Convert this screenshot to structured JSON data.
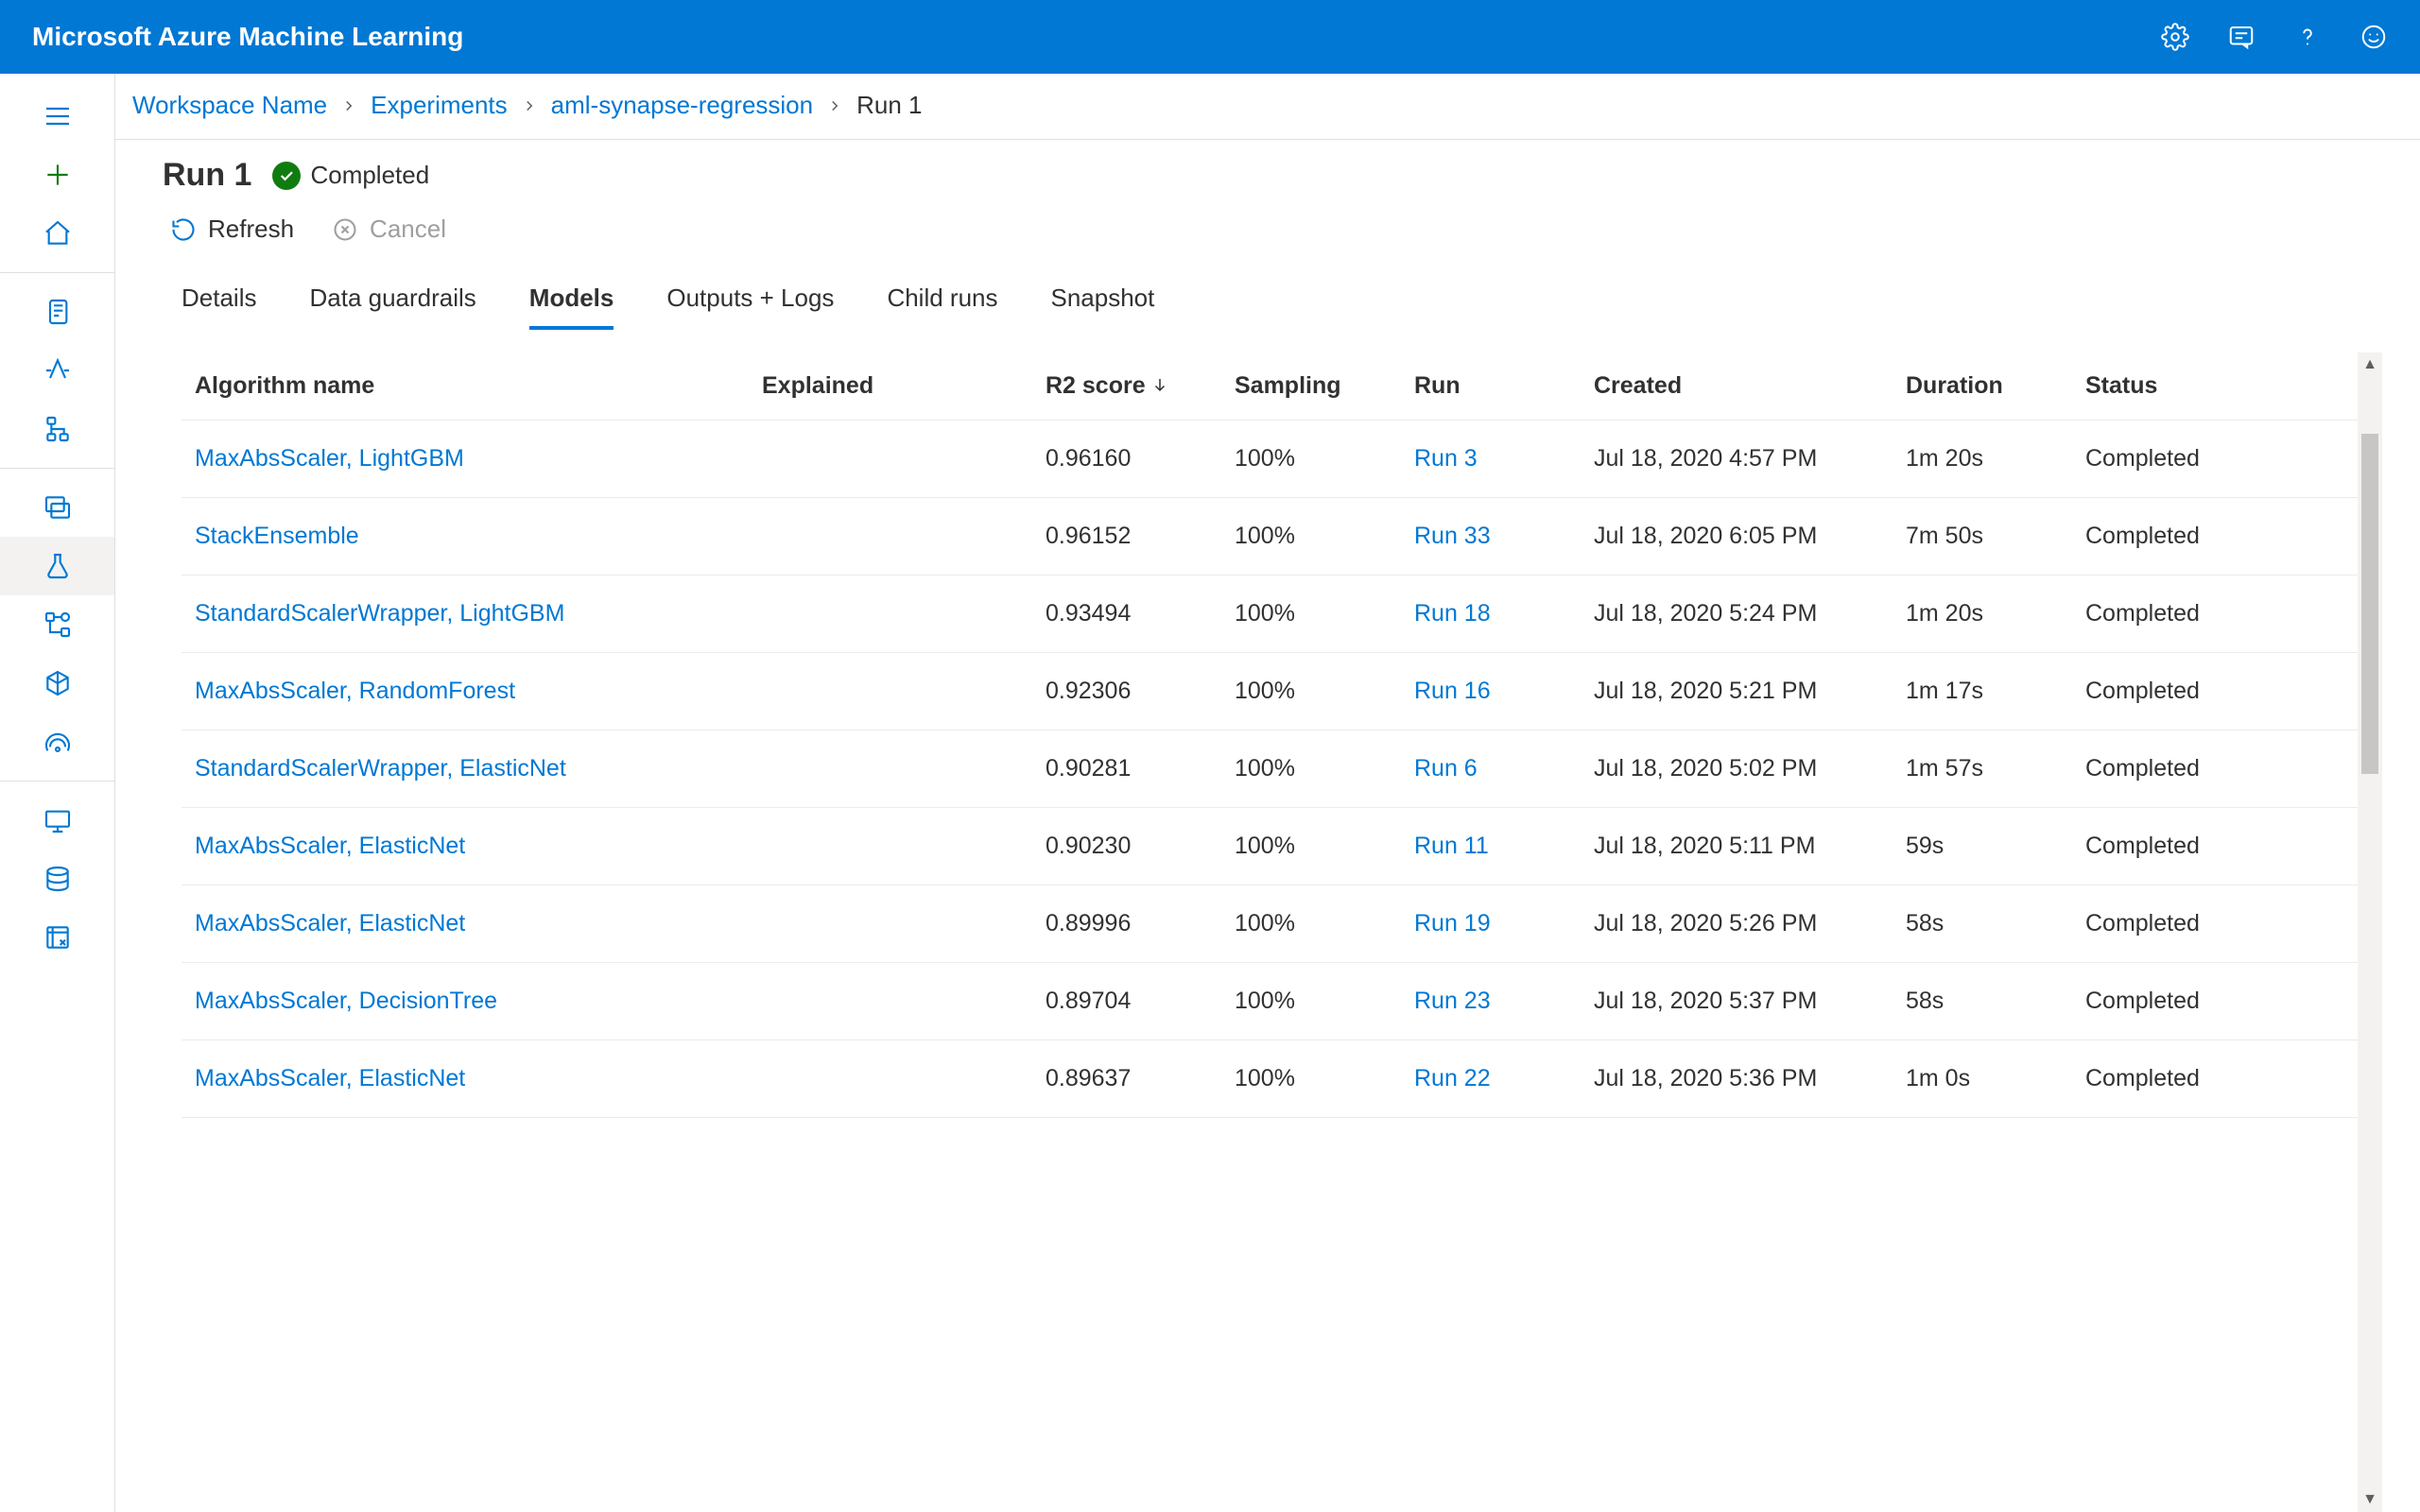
{
  "brand": "Microsoft Azure Machine Learning",
  "breadcrumbs": {
    "workspace": "Workspace Name",
    "experiments": "Experiments",
    "experiment_name": "aml-synapse-regression",
    "run": "Run 1"
  },
  "page": {
    "title": "Run 1",
    "status_label": "Completed"
  },
  "commands": {
    "refresh": "Refresh",
    "cancel": "Cancel"
  },
  "tabs": {
    "details": "Details",
    "data_guardrails": "Data guardrails",
    "models": "Models",
    "outputs_logs": "Outputs + Logs",
    "child_runs": "Child runs",
    "snapshot": "Snapshot"
  },
  "columns": {
    "algorithm": "Algorithm name",
    "explained": "Explained",
    "r2": "R2 score",
    "sampling": "Sampling",
    "run": "Run",
    "created": "Created",
    "duration": "Duration",
    "status": "Status"
  },
  "rows": [
    {
      "algorithm": "MaxAbsScaler, LightGBM",
      "explained": "",
      "r2": "0.96160",
      "sampling": "100%",
      "run": "Run 3",
      "created": "Jul 18, 2020 4:57 PM",
      "duration": "1m 20s",
      "status": "Completed"
    },
    {
      "algorithm": "StackEnsemble",
      "explained": "",
      "r2": "0.96152",
      "sampling": "100%",
      "run": "Run 33",
      "created": "Jul 18, 2020 6:05 PM",
      "duration": "7m 50s",
      "status": "Completed"
    },
    {
      "algorithm": "StandardScalerWrapper, LightGBM",
      "explained": "",
      "r2": "0.93494",
      "sampling": "100%",
      "run": "Run 18",
      "created": "Jul 18, 2020 5:24 PM",
      "duration": "1m 20s",
      "status": "Completed"
    },
    {
      "algorithm": "MaxAbsScaler, RandomForest",
      "explained": "",
      "r2": "0.92306",
      "sampling": "100%",
      "run": "Run 16",
      "created": "Jul 18, 2020 5:21 PM",
      "duration": "1m 17s",
      "status": "Completed"
    },
    {
      "algorithm": "StandardScalerWrapper, ElasticNet",
      "explained": "",
      "r2": "0.90281",
      "sampling": "100%",
      "run": "Run 6",
      "created": "Jul 18, 2020 5:02 PM",
      "duration": "1m 57s",
      "status": "Completed"
    },
    {
      "algorithm": "MaxAbsScaler, ElasticNet",
      "explained": "",
      "r2": "0.90230",
      "sampling": "100%",
      "run": "Run 11",
      "created": "Jul 18, 2020 5:11 PM",
      "duration": "59s",
      "status": "Completed"
    },
    {
      "algorithm": "MaxAbsScaler, ElasticNet",
      "explained": "",
      "r2": "0.89996",
      "sampling": "100%",
      "run": "Run 19",
      "created": "Jul 18, 2020 5:26 PM",
      "duration": "58s",
      "status": "Completed"
    },
    {
      "algorithm": "MaxAbsScaler, DecisionTree",
      "explained": "",
      "r2": "0.89704",
      "sampling": "100%",
      "run": "Run 23",
      "created": "Jul 18, 2020 5:37 PM",
      "duration": "58s",
      "status": "Completed"
    },
    {
      "algorithm": "MaxAbsScaler, ElasticNet",
      "explained": "",
      "r2": "0.89637",
      "sampling": "100%",
      "run": "Run 22",
      "created": "Jul 18, 2020 5:36 PM",
      "duration": "1m 0s",
      "status": "Completed"
    }
  ]
}
